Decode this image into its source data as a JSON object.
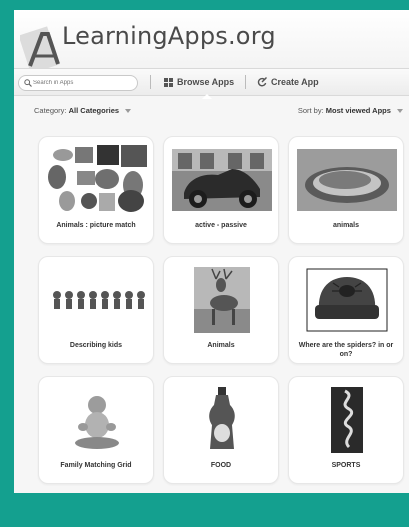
{
  "site": {
    "brand": "LearningApps.org"
  },
  "nav": {
    "search_placeholder": "Search in Apps",
    "browse_label": "Browse Apps",
    "create_label": "Create App"
  },
  "filters": {
    "category_label": "Category:",
    "category_value": "All Categories",
    "sort_label": "Sort by:",
    "sort_value": "Most viewed Apps"
  },
  "apps": [
    {
      "title": "Animals : picture match",
      "icon": "animal-collage-icon"
    },
    {
      "title": "active - passive",
      "icon": "vintage-car-icon"
    },
    {
      "title": "animals",
      "icon": "sleeping-cat-icon"
    },
    {
      "title": "Describing kids",
      "icon": "kids-row-icon"
    },
    {
      "title": "Animals",
      "icon": "deer-icon"
    },
    {
      "title": "Where are the spiders? in or on?",
      "icon": "armchair-spider-icon"
    },
    {
      "title": "Family Matching Grid",
      "icon": "baby-icon"
    },
    {
      "title": "FOOD",
      "icon": "syrup-bottle-icon"
    },
    {
      "title": "SPORTS",
      "icon": "climbing-rope-icon"
    }
  ],
  "colors": {
    "frame": "#14a08f",
    "background": "#f6f6f6",
    "card": "#ffffff"
  }
}
